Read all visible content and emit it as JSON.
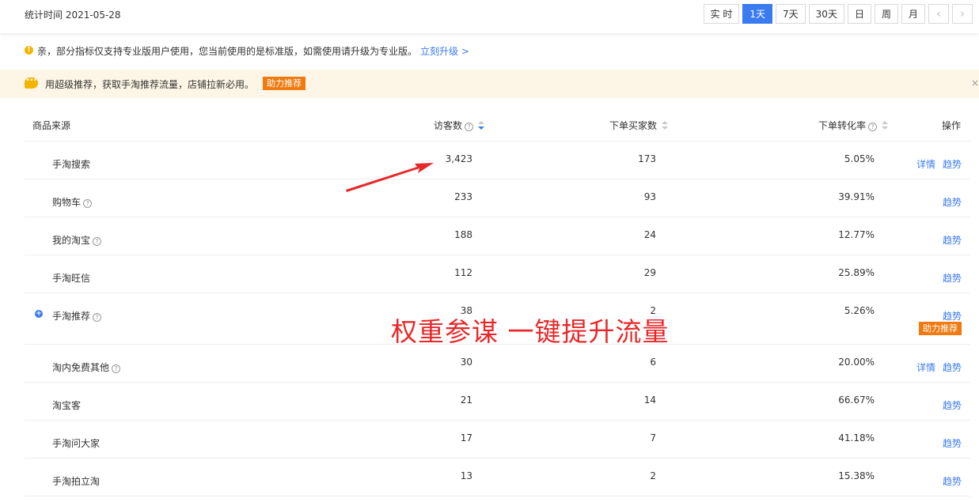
{
  "header": {
    "stat_time": "统计时间 2021-05-28",
    "periods": [
      {
        "label": "实 时",
        "active": false
      },
      {
        "label": "1天",
        "active": true
      },
      {
        "label": "7天",
        "active": false
      },
      {
        "label": "30天",
        "active": false
      },
      {
        "label": "日",
        "active": false
      },
      {
        "label": "周",
        "active": false
      },
      {
        "label": "月",
        "active": false
      }
    ],
    "prev": "‹",
    "next": "›"
  },
  "notice": {
    "icon": "!",
    "text": "亲，部分指标仅支持专业版用户使用，您当前使用的是标准版，如需使用请升级为专业版。",
    "link": "立刻升级 >"
  },
  "promo": {
    "text": "用超级推荐，获取手淘推荐流量，店铺拉新必用。",
    "button": "助力推荐",
    "close": "×"
  },
  "table": {
    "headers": {
      "source": "商品来源",
      "visitors": "访客数",
      "buyers": "下单买家数",
      "rate": "下单转化率",
      "ops": "操作"
    },
    "rows": [
      {
        "source": "手淘搜索",
        "help": false,
        "expand": false,
        "visitors": "3,423",
        "buyers": "173",
        "rate": "5.05%",
        "detail": "详情",
        "trend": "趋势"
      },
      {
        "source": "购物车",
        "help": true,
        "expand": false,
        "visitors": "233",
        "buyers": "93",
        "rate": "39.91%",
        "detail": "",
        "trend": "趋势"
      },
      {
        "source": "我的淘宝",
        "help": true,
        "expand": false,
        "visitors": "188",
        "buyers": "24",
        "rate": "12.77%",
        "detail": "",
        "trend": "趋势"
      },
      {
        "source": "手淘旺信",
        "help": false,
        "expand": false,
        "visitors": "112",
        "buyers": "29",
        "rate": "25.89%",
        "detail": "",
        "trend": "趋势"
      },
      {
        "source": "手淘推荐",
        "help": true,
        "expand": true,
        "visitors": "38",
        "buyers": "2",
        "rate": "5.26%",
        "detail": "",
        "trend": "趋势",
        "promo": "助力推荐"
      },
      {
        "source": "淘内免费其他",
        "help": true,
        "expand": false,
        "visitors": "30",
        "buyers": "6",
        "rate": "20.00%",
        "detail": "详情",
        "trend": "趋势"
      },
      {
        "source": "淘宝客",
        "help": false,
        "expand": false,
        "visitors": "21",
        "buyers": "14",
        "rate": "66.67%",
        "detail": "",
        "trend": "趋势"
      },
      {
        "source": "手淘问大家",
        "help": false,
        "expand": false,
        "visitors": "17",
        "buyers": "7",
        "rate": "41.18%",
        "detail": "",
        "trend": "趋势"
      },
      {
        "source": "手淘拍立淘",
        "help": false,
        "expand": false,
        "visitors": "13",
        "buyers": "2",
        "rate": "15.38%",
        "detail": "",
        "trend": "趋势"
      }
    ]
  },
  "annotation": {
    "text": "权重参谋  一键提升流量",
    "color": "#e8282a"
  },
  "colors": {
    "accent": "#3a7bf0",
    "promo_orange": "#f07a10",
    "promo_bg": "#fdf6e6"
  }
}
